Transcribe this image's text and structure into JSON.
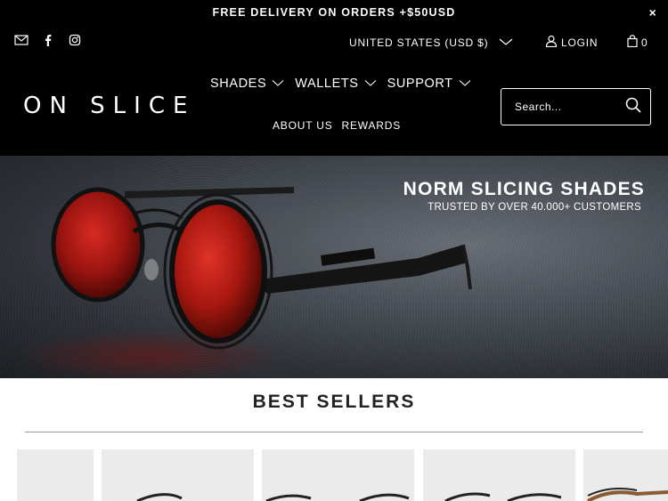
{
  "announcement": {
    "text": "FREE DELIVERY ON ORDERS +$50USD",
    "close": "×"
  },
  "header": {
    "social": [
      "email-icon",
      "facebook-icon",
      "instagram-icon"
    ],
    "currency": "UNITED STATES (USD $)",
    "login": "LOGIN",
    "cart_count": "0",
    "logo": "ON SLICE",
    "nav": [
      {
        "label": "SHADES"
      },
      {
        "label": "WALLETS"
      },
      {
        "label": "SUPPORT"
      }
    ],
    "subnav": [
      "ABOUT US",
      "REWARDS"
    ],
    "search_placeholder": "Search..."
  },
  "hero": {
    "title": "NORM SLICING SHADES",
    "subtitle": "TRUSTED BY OVER 40.000+ CUSTOMERS"
  },
  "best_sellers": {
    "title": "BEST SELLERS"
  },
  "colors": {
    "header_bg": "#000000",
    "lens_red": "#b01a1a",
    "text": "#222222"
  }
}
